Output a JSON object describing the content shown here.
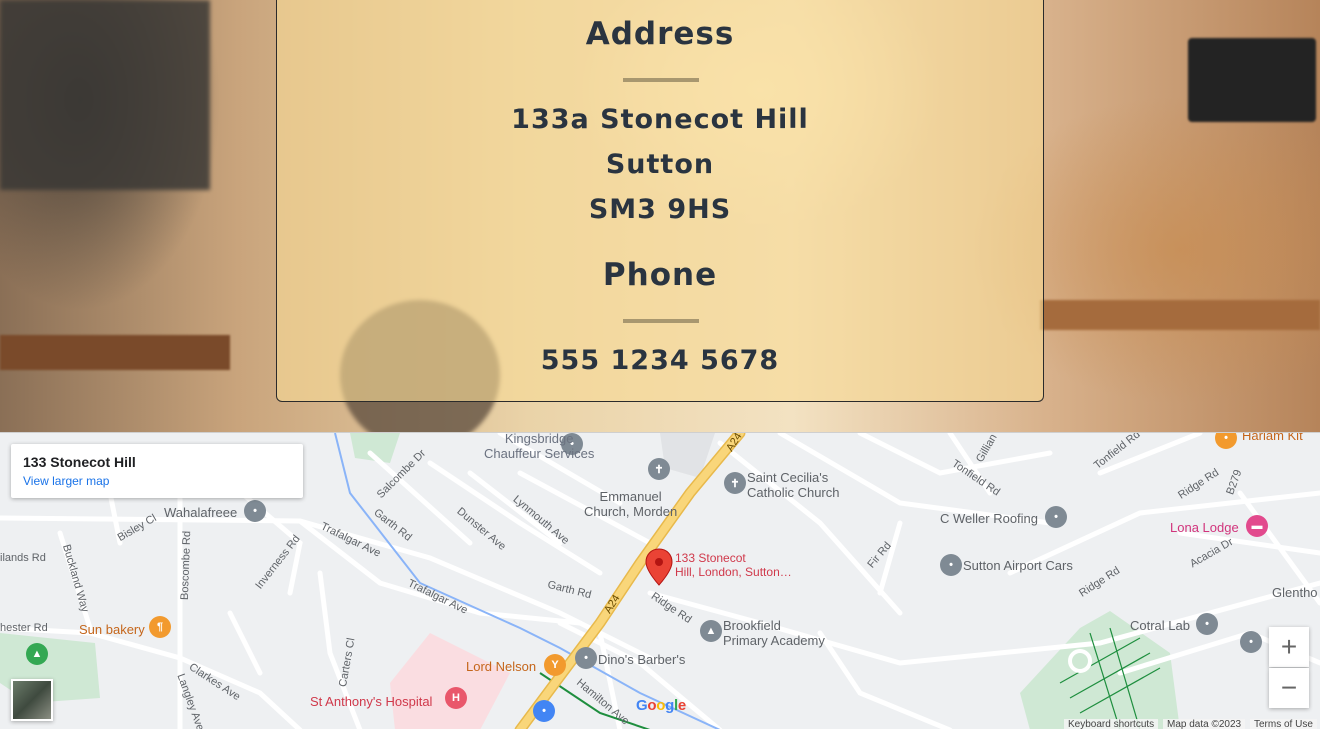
{
  "address_card": {
    "address_heading": "Address",
    "address_lines": [
      "133a Stonecot Hill",
      "Sutton",
      "SM3 9HS"
    ],
    "phone_heading": "Phone",
    "phone_number": "555 1234 5678"
  },
  "map": {
    "place_card": {
      "title": "133 Stonecot Hill",
      "link": "View larger map"
    },
    "marker_label_line1": "133 Stonecot",
    "marker_label_line2": "Hill, London, Sutton…",
    "places": {
      "kingsbridge": [
        "Kingsbridge",
        "Chauffeur Services"
      ],
      "emmanuel": [
        "Emmanuel",
        "Church, Morden"
      ],
      "st_cecilia": [
        "Saint Cecilia's",
        "Catholic Church"
      ],
      "c_weller": "C Weller Roofing",
      "sutton_airport_cars": "Sutton Airport Cars",
      "lona_lodge": "Lona Lodge",
      "cotral_lab": "Cotral Lab",
      "brookfield": [
        "Brookfield",
        "Primary Academy"
      ],
      "dinos": "Dino's Barber's",
      "lord_nelson": "Lord Nelson",
      "st_anthonys": "St Anthony's Hospital",
      "sun_bakery": "Sun bakery",
      "wahalafreee": "Wahalafreee",
      "harlam": "Harlam Kit",
      "glenthorne": "Glentho"
    },
    "roads": {
      "a24_top": "A24",
      "a24": "A24",
      "salcombe": "Salcombe Dr",
      "garth_rd_1": "Garth Rd",
      "garth_rd_2": "Garth Rd",
      "dunster": "Dunster Ave",
      "lynmouth": "Lynmouth Ave",
      "trafalgar_1": "Trafalgar Ave",
      "trafalgar_2": "Trafalgar Ave",
      "bisley": "Bisley Cl",
      "boscombe": "Boscombe Rd",
      "buckland": "Buckland Way",
      "inverness": "Inverness Rd",
      "carters": "Carters Cl",
      "clarkes": "Clarkes Ave",
      "langley": "Langley Ave",
      "hamilton": "Hamilton Ave",
      "ridge_rd_1": "Ridge Rd",
      "ridge_rd_2": "Ridge Rd",
      "ridge_rd_3": "Ridge Rd",
      "fir_rd": "Fir Rd",
      "tonfield_1": "Tonfield Rd",
      "tonfield_2": "Tonfield Rd",
      "gillian": "Gillian",
      "acacia": "Acacia Dr",
      "b279": "B279",
      "nilands": "ilands Rd",
      "chester": "hester Rd"
    },
    "zoom_in": "+",
    "zoom_out": "−",
    "attribution": {
      "keyboard": "Keyboard shortcuts",
      "map_data": "Map data ©2023",
      "terms": "Terms of Use"
    },
    "google_letters": [
      "G",
      "o",
      "o",
      "g",
      "l",
      "e"
    ],
    "colors": {
      "google_blue": "#4285f4",
      "google_red": "#ea4335",
      "google_yellow": "#fbbc05",
      "google_green": "#34a853",
      "major_road": "#f9d67a",
      "marker_red": "#ea4335"
    }
  }
}
